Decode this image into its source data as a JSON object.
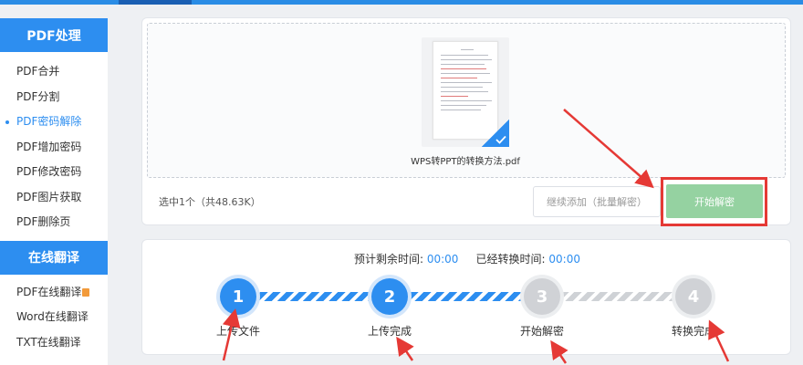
{
  "sidebar": {
    "section1_title": "PDF处理",
    "items1": [
      {
        "label": "PDF合并"
      },
      {
        "label": "PDF分割"
      },
      {
        "label": "PDF密码解除"
      },
      {
        "label": "PDF增加密码"
      },
      {
        "label": "PDF修改密码"
      },
      {
        "label": "PDF图片获取"
      },
      {
        "label": "PDF删除页"
      }
    ],
    "active_item": "PDF密码解除",
    "section2_title": "在线翻译",
    "items2": [
      {
        "label": "PDF在线翻译"
      },
      {
        "label": "Word在线翻译"
      },
      {
        "label": "TXT在线翻译"
      }
    ]
  },
  "upload": {
    "file_name": "WPS转PPT的转换方法.pdf",
    "selection_info": "选中1个（共48.63K）",
    "add_button": "继续添加（批量解密）",
    "start_button": "开始解密"
  },
  "progress": {
    "remaining_label": "预计剩余时间:",
    "remaining_value": "00:00",
    "elapsed_label": "已经转换时间:",
    "elapsed_value": "00:00",
    "steps": [
      {
        "number": "1",
        "label": "上传文件",
        "state": "done"
      },
      {
        "number": "2",
        "label": "上传完成",
        "state": "done"
      },
      {
        "number": "3",
        "label": "开始解密",
        "state": "pending"
      },
      {
        "number": "4",
        "label": "转换完成",
        "state": "pending"
      }
    ]
  },
  "colors": {
    "accent": "#2d8ef0",
    "start_button": "#95d2a1",
    "annotation": "#e53935"
  }
}
